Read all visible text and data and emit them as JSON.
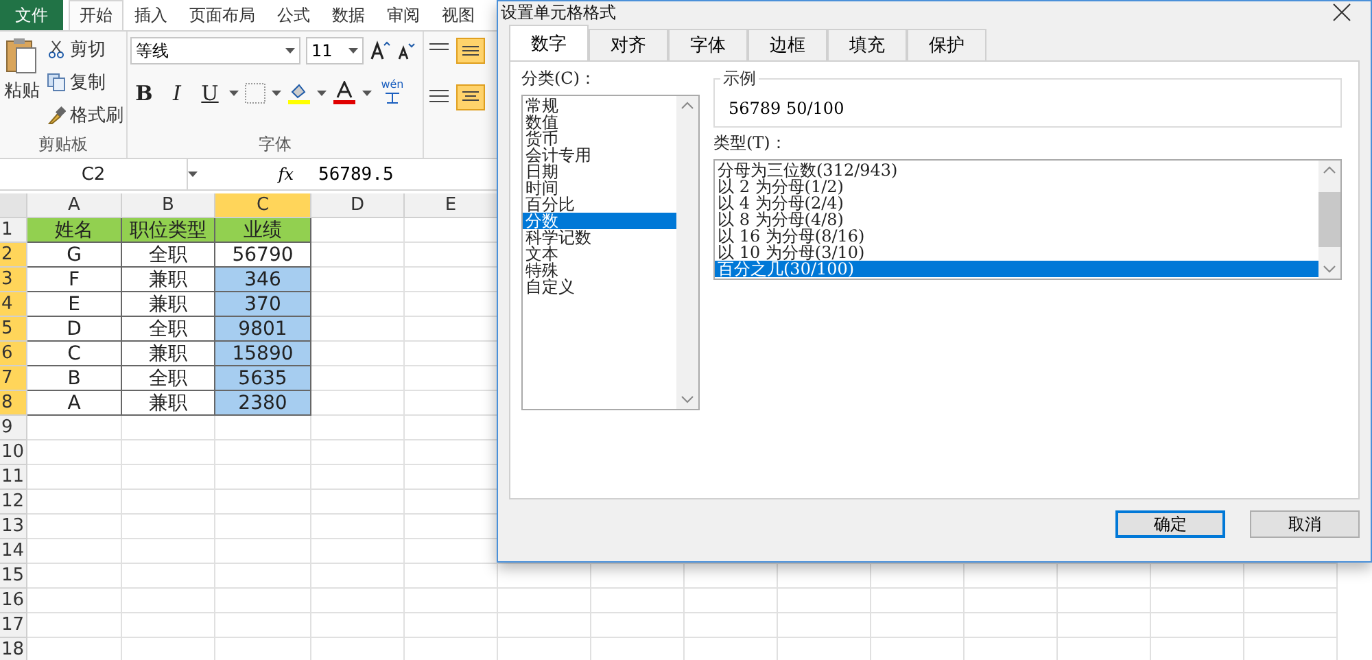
{
  "ribbon": {
    "tabs": [
      {
        "label": "文件",
        "kind": "file",
        "selected": false
      },
      {
        "label": "开始",
        "kind": "tab",
        "selected": true
      },
      {
        "label": "插入",
        "kind": "tab",
        "selected": false
      },
      {
        "label": "页面布局",
        "kind": "tab",
        "selected": false
      },
      {
        "label": "公式",
        "kind": "tab",
        "selected": false
      },
      {
        "label": "数据",
        "kind": "tab",
        "selected": false
      },
      {
        "label": "审阅",
        "kind": "tab",
        "selected": false
      },
      {
        "label": "视图",
        "kind": "tab",
        "selected": false
      }
    ],
    "clipboard": {
      "paste": "粘贴",
      "cut": "剪切",
      "copy": "复制",
      "format_painter": "格式刷",
      "label": "剪贴板"
    },
    "font": {
      "name": "等线",
      "size": "11",
      "bold": "B",
      "italic": "I",
      "underline": "U",
      "phonetic": "wén",
      "label": "字体"
    }
  },
  "formula_bar": {
    "name_box": "C2",
    "fx": "fx",
    "value": "56789.5"
  },
  "sheet": {
    "columns": [
      {
        "label": "A",
        "selected": false
      },
      {
        "label": "B",
        "selected": false
      },
      {
        "label": "C",
        "selected": true
      },
      {
        "label": "D",
        "selected": false
      },
      {
        "label": "E",
        "selected": false
      }
    ],
    "rows": [
      {
        "label": "1",
        "selected": false,
        "cells": [
          {
            "text": "姓名",
            "kind": "header"
          },
          {
            "text": "职位类型",
            "kind": "header"
          },
          {
            "text": "业绩",
            "kind": "header"
          }
        ]
      },
      {
        "label": "2",
        "selected": true,
        "cells": [
          {
            "text": "G",
            "kind": "data"
          },
          {
            "text": "全职",
            "kind": "data"
          },
          {
            "text": "56790",
            "kind": "active"
          }
        ]
      },
      {
        "label": "3",
        "selected": true,
        "cells": [
          {
            "text": "F",
            "kind": "data"
          },
          {
            "text": "兼职",
            "kind": "data"
          },
          {
            "text": "346",
            "kind": "selected"
          }
        ]
      },
      {
        "label": "4",
        "selected": true,
        "cells": [
          {
            "text": "E",
            "kind": "data"
          },
          {
            "text": "兼职",
            "kind": "data"
          },
          {
            "text": "370",
            "kind": "selected"
          }
        ]
      },
      {
        "label": "5",
        "selected": true,
        "cells": [
          {
            "text": "D",
            "kind": "data"
          },
          {
            "text": "全职",
            "kind": "data"
          },
          {
            "text": "9801",
            "kind": "selected"
          }
        ]
      },
      {
        "label": "6",
        "selected": true,
        "cells": [
          {
            "text": "C",
            "kind": "data"
          },
          {
            "text": "兼职",
            "kind": "data"
          },
          {
            "text": "15890",
            "kind": "selected"
          }
        ]
      },
      {
        "label": "7",
        "selected": true,
        "cells": [
          {
            "text": "B",
            "kind": "data"
          },
          {
            "text": "全职",
            "kind": "data"
          },
          {
            "text": "5635",
            "kind": "selected"
          }
        ]
      },
      {
        "label": "8",
        "selected": true,
        "cells": [
          {
            "text": "A",
            "kind": "data"
          },
          {
            "text": "兼职",
            "kind": "data"
          },
          {
            "text": "2380",
            "kind": "selected"
          }
        ]
      },
      {
        "label": "9",
        "selected": false,
        "cells": []
      },
      {
        "label": "10",
        "selected": false,
        "cells": []
      },
      {
        "label": "11",
        "selected": false,
        "cells": []
      },
      {
        "label": "12",
        "selected": false,
        "cells": []
      },
      {
        "label": "13",
        "selected": false,
        "cells": []
      },
      {
        "label": "14",
        "selected": false,
        "cells": []
      },
      {
        "label": "15",
        "selected": false,
        "cells": []
      },
      {
        "label": "16",
        "selected": false,
        "cells": []
      },
      {
        "label": "17",
        "selected": false,
        "cells": []
      },
      {
        "label": "18",
        "selected": false,
        "cells": []
      }
    ]
  },
  "dialog": {
    "title": "设置单元格格式",
    "tabs": [
      {
        "label": "数字",
        "selected": true
      },
      {
        "label": "对齐",
        "selected": false
      },
      {
        "label": "字体",
        "selected": false
      },
      {
        "label": "边框",
        "selected": false
      },
      {
        "label": "填充",
        "selected": false
      },
      {
        "label": "保护",
        "selected": false
      }
    ],
    "category_label": "分类(C)：",
    "categories": [
      {
        "label": "常规",
        "selected": false
      },
      {
        "label": "数值",
        "selected": false
      },
      {
        "label": "货币",
        "selected": false
      },
      {
        "label": "会计专用",
        "selected": false
      },
      {
        "label": "日期",
        "selected": false
      },
      {
        "label": "时间",
        "selected": false
      },
      {
        "label": "百分比",
        "selected": false
      },
      {
        "label": "分数",
        "selected": true
      },
      {
        "label": "科学记数",
        "selected": false
      },
      {
        "label": "文本",
        "selected": false
      },
      {
        "label": "特殊",
        "selected": false
      },
      {
        "label": "自定义",
        "selected": false
      }
    ],
    "sample_label": "示例",
    "sample_value": "56789 50/100",
    "type_label": "类型(T)：",
    "types": [
      {
        "label": "分母为三位数(312/943)",
        "selected": false
      },
      {
        "label": "以 2 为分母(1/2)",
        "selected": false
      },
      {
        "label": "以 4 为分母(2/4)",
        "selected": false
      },
      {
        "label": "以 8 为分母(4/8)",
        "selected": false
      },
      {
        "label": "以 16 为分母(8/16)",
        "selected": false
      },
      {
        "label": "以 10 为分母(3/10)",
        "selected": false
      },
      {
        "label": "百分之几(30/100)",
        "selected": true
      }
    ],
    "buttons": [
      {
        "label": "确定",
        "default": true
      },
      {
        "label": "取消",
        "default": false
      }
    ]
  }
}
